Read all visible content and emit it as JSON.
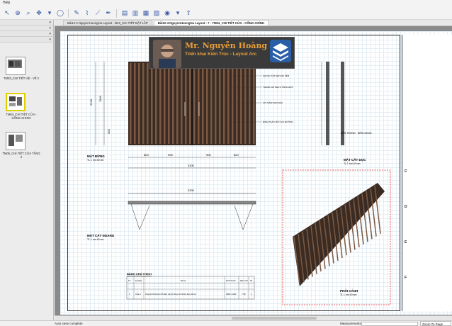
{
  "menubar": {
    "help": "Help"
  },
  "tabs": [
    {
      "label": "Bài12-4 NguyenHuongHa Layout - 2D4_CHI TIẾT BẬT LẮP",
      "active": false
    },
    {
      "label": "Bài12-4 NguyenHuongHa Layout - 7 - TM04_CHI TIẾT CỬA - CỔNG CHÍNH",
      "active": true
    }
  ],
  "sidebar": {
    "pages": [
      {
        "label": "TM03_CHI TIẾT HỆ - VẾ 2",
        "selected": false
      },
      {
        "label": "TM04_CHI TIẾT CỬA - CỔNG CHÍNH",
        "selected": true
      },
      {
        "label": "TM05_CHI TIẾT CỬA TẦNG 2",
        "selected": false
      }
    ]
  },
  "overlay": {
    "name": "Mr. Nguyễn Hoàng Hà",
    "subtitle": "Triển khai Kiến Trúc - Layout Arc"
  },
  "drawing": {
    "elevation_label": "MẶT ĐỨNG",
    "elevation_scale": "TL 1 nm 40 nm",
    "section_v_label": "MẶT CẮT DỌC",
    "section_v_scale": "TL 1 nm 40 nm",
    "plan_label": "MẶT CẮT NGANG",
    "plan_scale": "TL 1 nm 40 nm",
    "perspective_label": "PHỐI CẢNH",
    "perspective_scale": "TL 1 nm 40 nm",
    "inside_label": "BÊN TRONG",
    "outside_label": "BÊN NGOÀI",
    "dim_total": "3300",
    "dim_left": "800",
    "dim_mid1": "900",
    "dim_mid2": "900",
    "dim_right": "800",
    "dim_height": "2240",
    "dim_h2": "1940",
    "dim_h3": "900",
    "plan_dim": "3300",
    "notes": [
      "KHUNG SẮT ĐEN MẠ KẼM",
      "THANG GỖ NHỰA TỔNG HỢP",
      "TAY NẮM INOX ĐẶC",
      "ĐINH PHẢN HỒI CỬA ĐƯỜNG"
    ],
    "table_title": "BẢNG CHÚ THÍCH",
    "table_headers": [
      "TT",
      "Ký hiệu",
      "Mô tả",
      "Kích thước",
      "Diện tích",
      "SL"
    ],
    "table_row": [
      "1",
      "Cửa 1",
      "Cổng chính sắt sơn tĩnh điện, nan gỗ nhựa, kích thước theo bản vẽ",
      "3300 x 2240",
      "7.39",
      "1"
    ]
  },
  "titleblock": {
    "letters": [
      "C",
      "D",
      "E",
      "F"
    ]
  },
  "statusbar": {
    "status": "Auto save complete",
    "measurements": "Measurements",
    "zoom": "Zoom To Page"
  }
}
